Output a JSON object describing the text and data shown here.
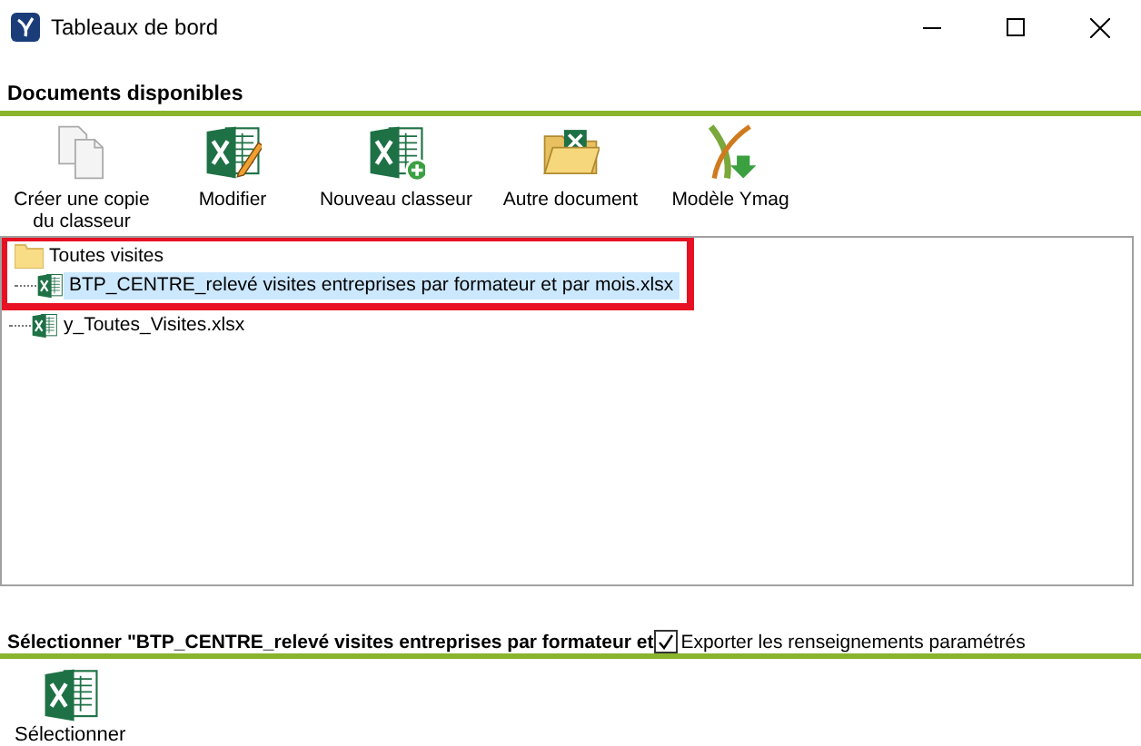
{
  "window": {
    "title": "Tableaux de bord"
  },
  "available_section": {
    "title": "Documents disponibles"
  },
  "toolbar": [
    {
      "label": "Créer une copie du classeur",
      "kind": "copy"
    },
    {
      "label": "Modifier",
      "kind": "edit"
    },
    {
      "label": "Nouveau classeur",
      "kind": "new"
    },
    {
      "label": "Autre document",
      "kind": "other"
    },
    {
      "label": "Modèle Ymag",
      "kind": "template"
    }
  ],
  "tree": [
    {
      "label": "Toutes visites",
      "kind": "folder",
      "highlighted": true,
      "selected": false,
      "children": [
        {
          "label": "BTP_CENTRE_relevé visites entreprises par formateur et par mois.xlsx",
          "kind": "file",
          "highlighted": true,
          "selected": true
        },
        {
          "label": "y_Toutes_Visites.xlsx",
          "kind": "file",
          "highlighted": false,
          "selected": false
        }
      ]
    }
  ],
  "selection": {
    "title": "Sélectionner \"BTP_CENTRE_relevé visites entreprises par formateur et",
    "export_option": {
      "label": "Exporter les renseignements paramétrés",
      "checked": true
    }
  },
  "actions": [
    {
      "label": "Sélectionner",
      "kind": "excel"
    }
  ]
}
